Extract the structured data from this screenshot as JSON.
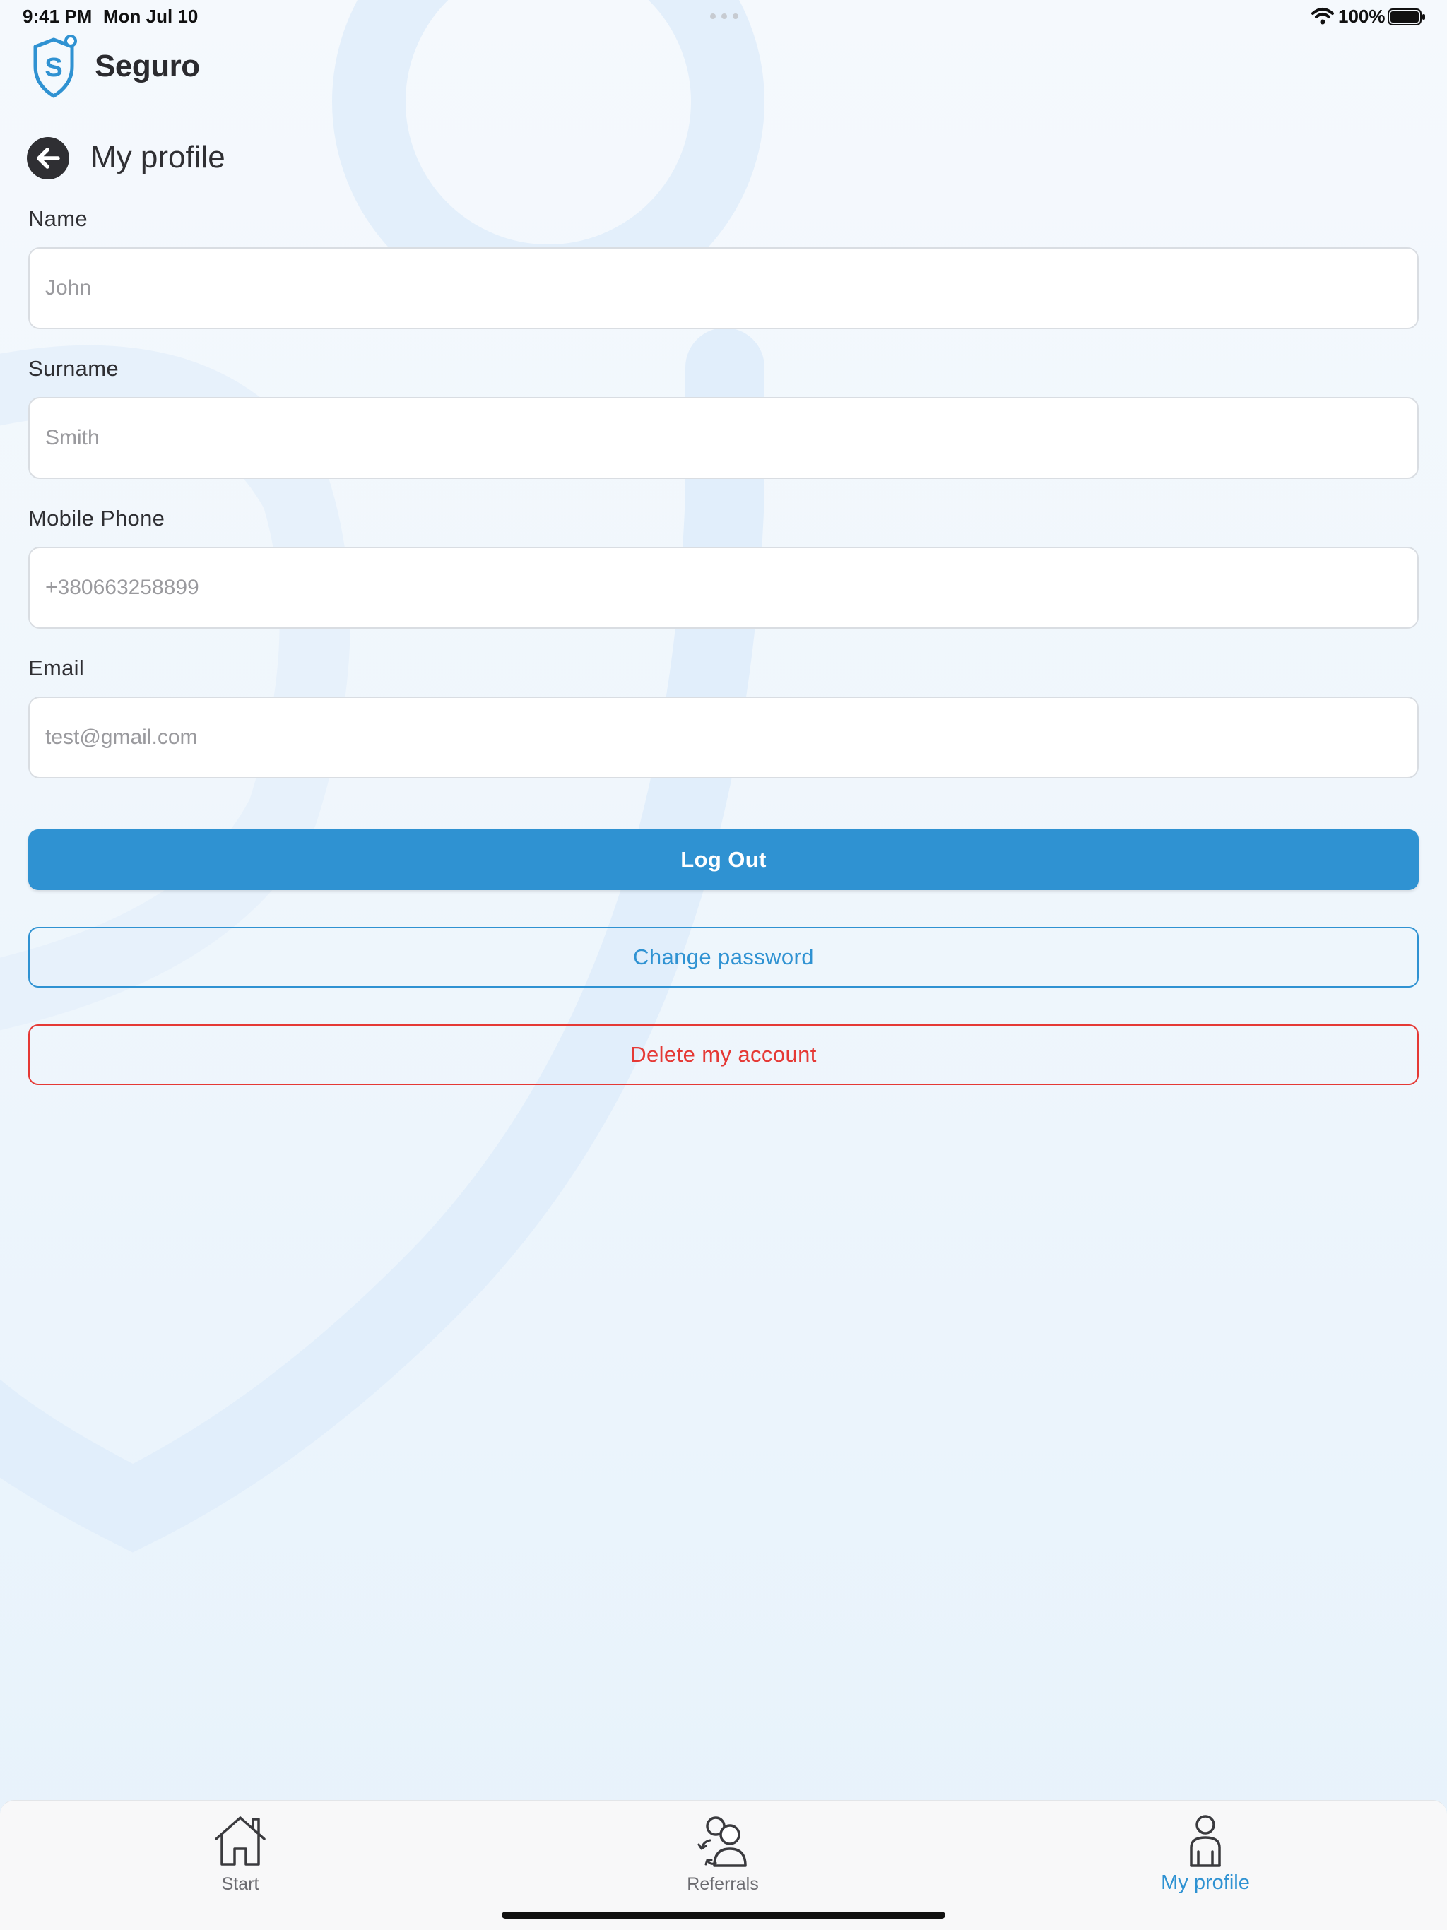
{
  "status_bar": {
    "time": "9:41 PM",
    "date": "Mon Jul 10",
    "battery": "100%"
  },
  "app": {
    "logo_text": "Seguro"
  },
  "header": {
    "title": "My profile"
  },
  "fields": {
    "name": {
      "label": "Name",
      "placeholder": "John"
    },
    "surname": {
      "label": "Surname",
      "placeholder": "Smith"
    },
    "phone": {
      "label": "Mobile Phone",
      "placeholder": "+380663258899"
    },
    "email": {
      "label": "Email",
      "placeholder": "test@gmail.com"
    }
  },
  "actions": {
    "logout": "Log Out",
    "change_password": "Change password",
    "delete_account": "Delete my account"
  },
  "tabs": [
    {
      "label": "Start",
      "icon": "home-icon"
    },
    {
      "label": "Referrals",
      "icon": "referrals-icon"
    },
    {
      "label": "My profile",
      "icon": "profile-icon",
      "active": true
    }
  ],
  "colors": {
    "accent": "#2f92d2",
    "danger": "#e53935",
    "text": "#2f2f33"
  }
}
